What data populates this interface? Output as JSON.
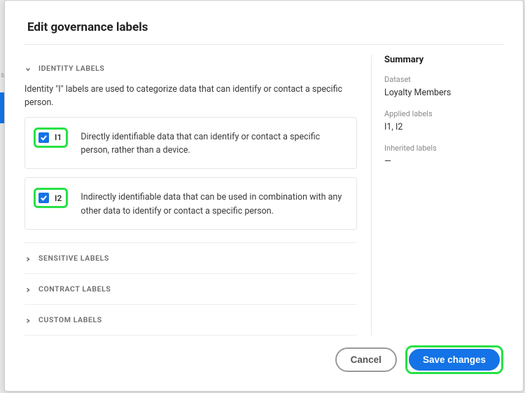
{
  "header": {
    "title": "Edit governance labels"
  },
  "sections": {
    "identity": {
      "label": "IDENTITY LABELS",
      "description": "Identity \"I\" labels are used to categorize data that can identify or contact a specific person.",
      "items": [
        {
          "code": "I1",
          "checked": true,
          "text": "Directly identifiable data that can identify or contact a specific person, rather than a device."
        },
        {
          "code": "I2",
          "checked": true,
          "text": "Indirectly identifiable data that can be used in combination with any other data to identify or contact a specific person."
        }
      ]
    },
    "sensitive": {
      "label": "SENSITIVE LABELS"
    },
    "contract": {
      "label": "CONTRACT LABELS"
    },
    "custom": {
      "label": "CUSTOM LABELS"
    }
  },
  "summary": {
    "heading": "Summary",
    "dataset_label": "Dataset",
    "dataset_value": "Loyalty Members",
    "applied_label": "Applied labels",
    "applied_value": "I1, I2",
    "inherited_label": "Inherited labels",
    "inherited_value": "—"
  },
  "footer": {
    "cancel": "Cancel",
    "save": "Save changes"
  }
}
